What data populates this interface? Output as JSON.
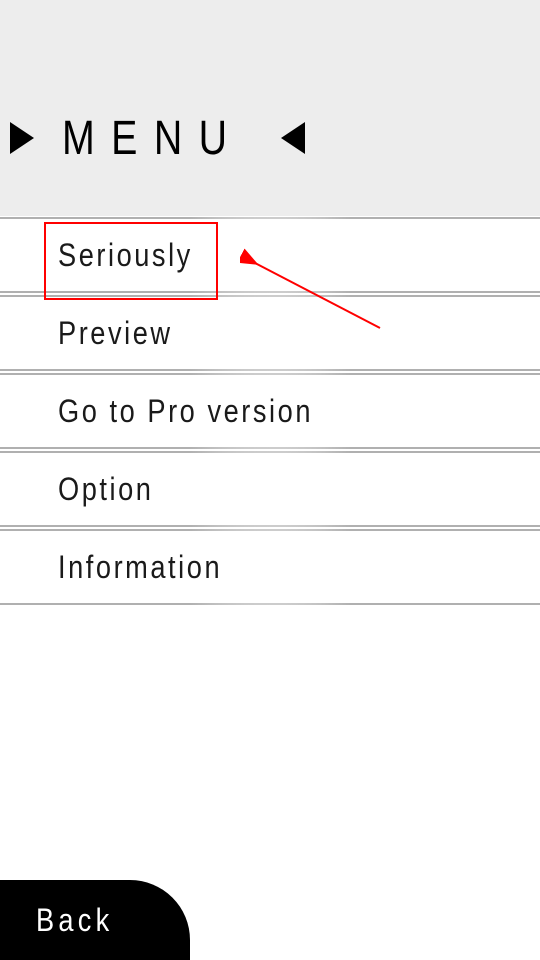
{
  "header": {
    "title": "MENU"
  },
  "menu": {
    "items": [
      {
        "label": "Seriously"
      },
      {
        "label": "Preview"
      },
      {
        "label": "Go to Pro version"
      },
      {
        "label": "Option"
      },
      {
        "label": "Information"
      }
    ]
  },
  "footer": {
    "back_label": "Back"
  },
  "colors": {
    "highlight": "#ff0000",
    "header_bg": "#ededed"
  }
}
